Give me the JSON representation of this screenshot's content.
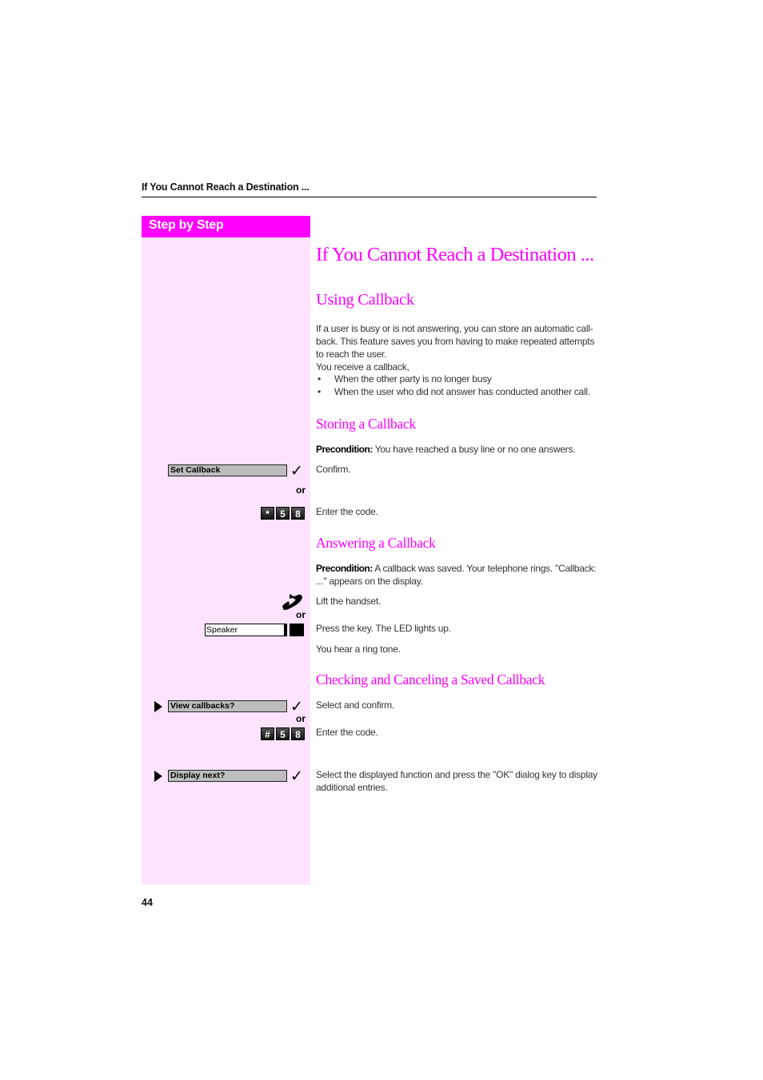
{
  "header": {
    "running_title": "If You Cannot Reach a Destination ..."
  },
  "sidebar": {
    "label": "Step by Step"
  },
  "main": {
    "title": "If You Cannot Reach a Destination ...",
    "section_using": {
      "heading": "Using Callback",
      "paragraph_lines": [
        "If a user is busy or is not answering, you can store an automatic call-",
        "back. This feature saves you from having to make repeated attempts",
        "to reach the user.",
        "You receive a callback,"
      ],
      "bullets": [
        "When the other party is no longer busy",
        "When the user who did not answer has conducted another call."
      ]
    },
    "section_storing": {
      "heading": "Storing a Callback",
      "precondition_label": "Precondition:",
      "precondition_text": " You have reached a busy line or no one answers.",
      "step_confirm": "Confirm.",
      "step_code": "Enter the code.",
      "display_option": "Set Callback",
      "or_label": "or",
      "code_keys": [
        "*",
        "5",
        "8"
      ]
    },
    "section_answering": {
      "heading": "Answering a Callback",
      "precondition_label": "Precondition:",
      "precondition_line1": " A callback was saved. Your telephone rings. \"Callback:",
      "precondition_line2": "...\" appears on the display.",
      "step_lift": "Lift the handset.",
      "step_press": "Press the key. The LED lights up.",
      "step_ring": "You hear a ring tone.",
      "or_label": "or",
      "speaker_key_label": "Speaker"
    },
    "section_checking": {
      "heading": "Checking and Canceling a Saved Callback",
      "display_option_1": "View callbacks?",
      "step_select": "Select and confirm.",
      "or_label": "or",
      "code_keys": [
        "#",
        "5",
        "8"
      ],
      "step_code": "Enter the code.",
      "display_option_2": "Display next?",
      "step_display_next_line1": "Select the displayed function and press the \"OK\" dialog key to display",
      "step_display_next_line2": "additional entries."
    }
  },
  "footer": {
    "page_number": "44"
  },
  "colors": {
    "accent": "#ff00ff",
    "sidebar_bg": "#fde3fd",
    "display_bg": "#bdbdbd"
  }
}
